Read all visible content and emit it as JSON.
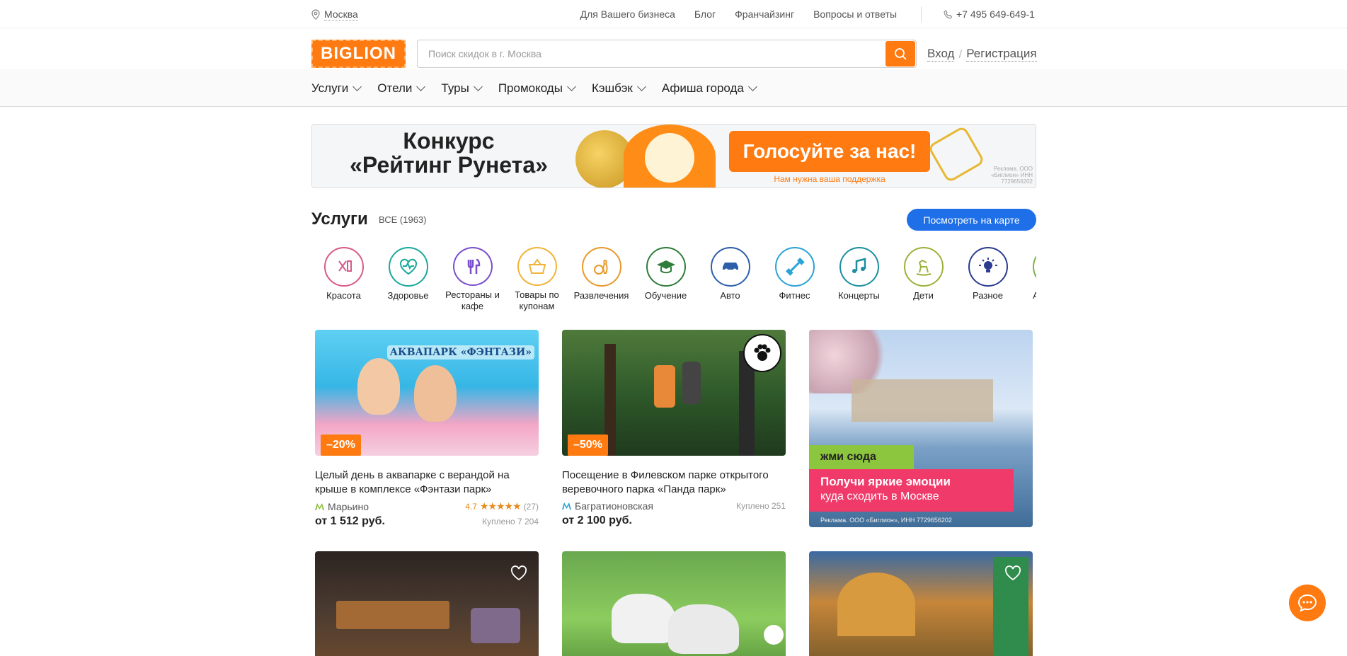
{
  "topbar": {
    "city": "Москва",
    "links": [
      "Для Вашего бизнеса",
      "Блог",
      "Франчайзинг",
      "Вопросы и ответы"
    ],
    "phone": "+7 495 649-649-1"
  },
  "header": {
    "logo": "BIGLION",
    "search_placeholder": "Поиск скидок в г. Москва",
    "login": "Вход",
    "separator": "/",
    "register": "Регистрация"
  },
  "nav": {
    "items": [
      "Услуги",
      "Отели",
      "Туры",
      "Промокоды",
      "Кэшбэк",
      "Афиша города"
    ]
  },
  "banner": {
    "title_line1": "Конкурс",
    "title_line2": "«Рейтинг Рунета»",
    "vote": "Голосуйте за нас!",
    "support": "Нам нужна ваша поддержка",
    "ad": "Реклама. ООО «Биглион» ИНН 7729656202"
  },
  "section": {
    "title": "Услуги",
    "count": "ВСЕ (1963)",
    "map_button": "Посмотреть на карте"
  },
  "categories": [
    {
      "label": "Красота",
      "icon": "scissors-comb-icon",
      "color": "#d9598a"
    },
    {
      "label": "Здоровье",
      "icon": "heart-pulse-icon",
      "color": "#19a99a"
    },
    {
      "label": "Рестораны и кафе",
      "icon": "fork-knife-icon",
      "color": "#7a4fcf"
    },
    {
      "label": "Товары по купонам",
      "icon": "basket-icon",
      "color": "#f0b43a"
    },
    {
      "label": "Развлечения",
      "icon": "bowling-icon",
      "color": "#e89a2a"
    },
    {
      "label": "Обучение",
      "icon": "graduation-cap-icon",
      "color": "#2f7d3a"
    },
    {
      "label": "Авто",
      "icon": "car-icon",
      "color": "#2d5fa8"
    },
    {
      "label": "Фитнес",
      "icon": "dumbbell-icon",
      "color": "#2aa3d6"
    },
    {
      "label": "Концерты",
      "icon": "music-note-icon",
      "color": "#1b8fa0"
    },
    {
      "label": "Дети",
      "icon": "rocking-horse-icon",
      "color": "#9ab23a"
    },
    {
      "label": "Разное",
      "icon": "lightbulb-icon",
      "color": "#2b3d8f"
    },
    {
      "label": "А… По…",
      "icon": "gift-icon",
      "color": "#7cb24a"
    }
  ],
  "cards": [
    {
      "discount": "–20%",
      "title": "Целый день в аквапарке с верандой на крыше в комплексе «Фэнтази парк»",
      "metro": "Марьино",
      "metro_color": "#8dbf3f",
      "rating": "4.7",
      "stars": 5,
      "reviews": "(27)",
      "price": "от 1 512 руб.",
      "sold": "Куплено 7 204",
      "image_logo": "АКВАПАРК «ФЭНТАЗИ»"
    },
    {
      "discount": "–50%",
      "title": "Посещение в Филевском парке открытого веревочного парка «Панда парк»",
      "metro": "Багратионовская",
      "metro_color": "#2aa3d6",
      "price": "от 2 100 руб.",
      "sold": "Куплено 251"
    }
  ],
  "promo": {
    "tag": "жми сюда",
    "headline": "Получи яркие эмоции",
    "subline": "куда сходить в Москве",
    "ad": "Реклама. ООО «Биглион», ИНН 7729656202"
  }
}
